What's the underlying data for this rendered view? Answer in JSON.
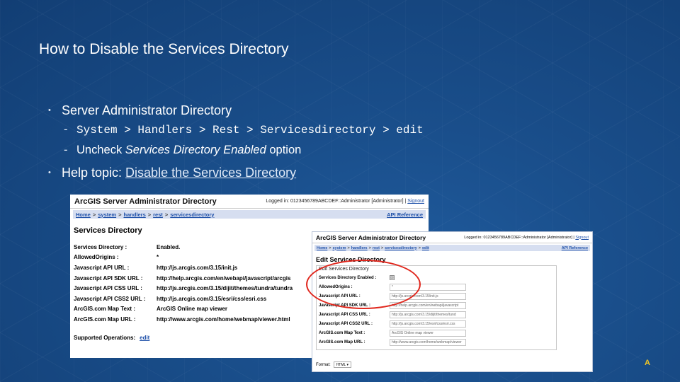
{
  "slide": {
    "title": "How to Disable the Services Directory",
    "bullets": {
      "b1": "Server Administrator Directory",
      "b1_sub1": "System > Handlers > Rest > Servicesdirectory > edit",
      "b1_sub2_italic": "Services Directory Enabled",
      "b1_sub2_pre": "Uncheck ",
      "b1_sub2_post": " option",
      "b2_pre": "Help topic: ",
      "b2_link": "Disable the Services Directory"
    },
    "corner_mark": "A"
  },
  "screenshot1": {
    "app_title": "ArcGIS Server Administrator Directory",
    "logged_in_label": "Logged in: 0123456789ABCDEF::Administrator [Administrator] |",
    "signout": "Signout",
    "breadcrumbs": [
      "Home",
      "system",
      "handlers",
      "rest",
      "servicesdirectory"
    ],
    "api_reference": "API Reference",
    "heading": "Services Directory",
    "rows": [
      {
        "key": "Services Directory :",
        "value": "Enabled."
      },
      {
        "key": "AllowedOrigins :",
        "value": "*"
      },
      {
        "key": "Javascript API URL :",
        "value": "http://js.arcgis.com/3.15/init.js"
      },
      {
        "key": "Javascript API SDK URL :",
        "value": "http://help.arcgis.com/en/webapi/javascript/arcgis"
      },
      {
        "key": "Javascript API CSS URL :",
        "value": "http://js.arcgis.com/3.15/dijit/themes/tundra/tundra"
      },
      {
        "key": "Javascript API CSS2 URL :",
        "value": "http://js.arcgis.com/3.15/esri/css/esri.css"
      },
      {
        "key": "ArcGIS.com Map Text :",
        "value": "ArcGIS Online map viewer"
      },
      {
        "key": "ArcGIS.com Map URL :",
        "value": "http://www.arcgis.com/home/webmap/viewer.html"
      }
    ],
    "supported_ops_label": "Supported Operations:",
    "edit_link": "edit"
  },
  "screenshot2": {
    "app_title": "ArcGIS Server Administrator Directory",
    "logged_in_label": "Logged in: 0123456789ABCDEF::Administrator [Administrator] |",
    "signout": "Signout",
    "breadcrumbs": [
      "Home",
      "system",
      "handlers",
      "rest",
      "servicesdirectory",
      "edit"
    ],
    "api_reference": "API Reference",
    "heading": "Edit Services Directory",
    "legend": "Edit Services Directory",
    "rows": [
      {
        "key": "Services Directory Enabled :",
        "value": "☒"
      },
      {
        "key": "AllowedOrigins :",
        "value": "*"
      },
      {
        "key": "Javascript API URL :",
        "value": "http://js.arcgis.com/3.15/init.js"
      },
      {
        "key": "Javascript API SDK URL :",
        "value": "http://help.arcgis.com/en/webapi/javascript"
      },
      {
        "key": "Javascript API CSS URL :",
        "value": "http://js.arcgis.com/3.15/dijit/themes/tund"
      },
      {
        "key": "Javascript API CSS2 URL :",
        "value": "http://js.arcgis.com/3.15/esri/css/esri.css"
      },
      {
        "key": "ArcGIS.com Map Text :",
        "value": "ArcGIS Online map viewer"
      },
      {
        "key": "ArcGIS.com Map URL :",
        "value": "http://www.arcgis.com/home/webmap/viewer"
      }
    ],
    "format_label": "Format:",
    "format_value": "HTML ▾"
  },
  "colors": {
    "slide_background": "#1a4f8c",
    "link_blue": "#1d4fa8",
    "highlight_red": "#e0261c",
    "nav_bar": "#d6def0"
  }
}
